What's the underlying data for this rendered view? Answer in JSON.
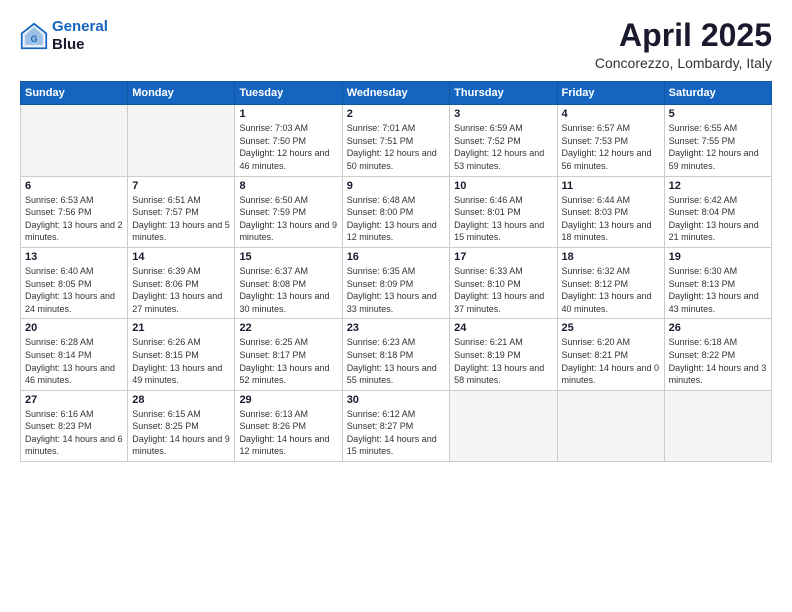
{
  "header": {
    "logo_line1": "General",
    "logo_line2": "Blue",
    "title": "April 2025",
    "subtitle": "Concorezzo, Lombardy, Italy"
  },
  "calendar": {
    "days_of_week": [
      "Sunday",
      "Monday",
      "Tuesday",
      "Wednesday",
      "Thursday",
      "Friday",
      "Saturday"
    ],
    "weeks": [
      [
        {
          "day": "",
          "info": ""
        },
        {
          "day": "",
          "info": ""
        },
        {
          "day": "1",
          "info": "Sunrise: 7:03 AM\nSunset: 7:50 PM\nDaylight: 12 hours and 46 minutes."
        },
        {
          "day": "2",
          "info": "Sunrise: 7:01 AM\nSunset: 7:51 PM\nDaylight: 12 hours and 50 minutes."
        },
        {
          "day": "3",
          "info": "Sunrise: 6:59 AM\nSunset: 7:52 PM\nDaylight: 12 hours and 53 minutes."
        },
        {
          "day": "4",
          "info": "Sunrise: 6:57 AM\nSunset: 7:53 PM\nDaylight: 12 hours and 56 minutes."
        },
        {
          "day": "5",
          "info": "Sunrise: 6:55 AM\nSunset: 7:55 PM\nDaylight: 12 hours and 59 minutes."
        }
      ],
      [
        {
          "day": "6",
          "info": "Sunrise: 6:53 AM\nSunset: 7:56 PM\nDaylight: 13 hours and 2 minutes."
        },
        {
          "day": "7",
          "info": "Sunrise: 6:51 AM\nSunset: 7:57 PM\nDaylight: 13 hours and 5 minutes."
        },
        {
          "day": "8",
          "info": "Sunrise: 6:50 AM\nSunset: 7:59 PM\nDaylight: 13 hours and 9 minutes."
        },
        {
          "day": "9",
          "info": "Sunrise: 6:48 AM\nSunset: 8:00 PM\nDaylight: 13 hours and 12 minutes."
        },
        {
          "day": "10",
          "info": "Sunrise: 6:46 AM\nSunset: 8:01 PM\nDaylight: 13 hours and 15 minutes."
        },
        {
          "day": "11",
          "info": "Sunrise: 6:44 AM\nSunset: 8:03 PM\nDaylight: 13 hours and 18 minutes."
        },
        {
          "day": "12",
          "info": "Sunrise: 6:42 AM\nSunset: 8:04 PM\nDaylight: 13 hours and 21 minutes."
        }
      ],
      [
        {
          "day": "13",
          "info": "Sunrise: 6:40 AM\nSunset: 8:05 PM\nDaylight: 13 hours and 24 minutes."
        },
        {
          "day": "14",
          "info": "Sunrise: 6:39 AM\nSunset: 8:06 PM\nDaylight: 13 hours and 27 minutes."
        },
        {
          "day": "15",
          "info": "Sunrise: 6:37 AM\nSunset: 8:08 PM\nDaylight: 13 hours and 30 minutes."
        },
        {
          "day": "16",
          "info": "Sunrise: 6:35 AM\nSunset: 8:09 PM\nDaylight: 13 hours and 33 minutes."
        },
        {
          "day": "17",
          "info": "Sunrise: 6:33 AM\nSunset: 8:10 PM\nDaylight: 13 hours and 37 minutes."
        },
        {
          "day": "18",
          "info": "Sunrise: 6:32 AM\nSunset: 8:12 PM\nDaylight: 13 hours and 40 minutes."
        },
        {
          "day": "19",
          "info": "Sunrise: 6:30 AM\nSunset: 8:13 PM\nDaylight: 13 hours and 43 minutes."
        }
      ],
      [
        {
          "day": "20",
          "info": "Sunrise: 6:28 AM\nSunset: 8:14 PM\nDaylight: 13 hours and 46 minutes."
        },
        {
          "day": "21",
          "info": "Sunrise: 6:26 AM\nSunset: 8:15 PM\nDaylight: 13 hours and 49 minutes."
        },
        {
          "day": "22",
          "info": "Sunrise: 6:25 AM\nSunset: 8:17 PM\nDaylight: 13 hours and 52 minutes."
        },
        {
          "day": "23",
          "info": "Sunrise: 6:23 AM\nSunset: 8:18 PM\nDaylight: 13 hours and 55 minutes."
        },
        {
          "day": "24",
          "info": "Sunrise: 6:21 AM\nSunset: 8:19 PM\nDaylight: 13 hours and 58 minutes."
        },
        {
          "day": "25",
          "info": "Sunrise: 6:20 AM\nSunset: 8:21 PM\nDaylight: 14 hours and 0 minutes."
        },
        {
          "day": "26",
          "info": "Sunrise: 6:18 AM\nSunset: 8:22 PM\nDaylight: 14 hours and 3 minutes."
        }
      ],
      [
        {
          "day": "27",
          "info": "Sunrise: 6:16 AM\nSunset: 8:23 PM\nDaylight: 14 hours and 6 minutes."
        },
        {
          "day": "28",
          "info": "Sunrise: 6:15 AM\nSunset: 8:25 PM\nDaylight: 14 hours and 9 minutes."
        },
        {
          "day": "29",
          "info": "Sunrise: 6:13 AM\nSunset: 8:26 PM\nDaylight: 14 hours and 12 minutes."
        },
        {
          "day": "30",
          "info": "Sunrise: 6:12 AM\nSunset: 8:27 PM\nDaylight: 14 hours and 15 minutes."
        },
        {
          "day": "",
          "info": ""
        },
        {
          "day": "",
          "info": ""
        },
        {
          "day": "",
          "info": ""
        }
      ]
    ]
  }
}
